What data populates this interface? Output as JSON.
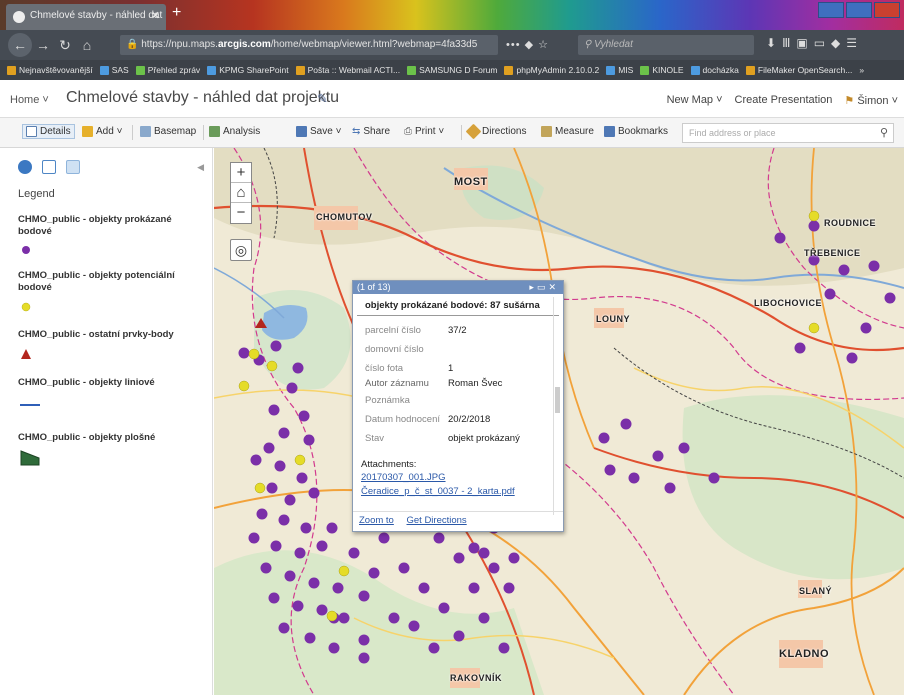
{
  "browser": {
    "tab_title": "Chmelové stavby - náhled dat",
    "new_tab_symbol": "+",
    "url_prefix": "https://npu.maps.",
    "url_domain": "arcgis.com",
    "url_rest": "/home/webmap/viewer.html?webmap=4fa33d5",
    "url_tail": "••• ◆ ☆",
    "search_placeholder": "Vyhledat",
    "bookmarks": [
      "Nejnavštěvovanější",
      "SAS",
      "Přehled zpráv",
      "KPMG SharePoint",
      "Pošta :: Webmail ACTI...",
      "SAMSUNG D Forum",
      "phpMyAdmin 2.10.0.2",
      "MIS",
      "KINOLE",
      "docházka",
      "FileMaker OpenSearch..."
    ],
    "bookmarks_more": "»"
  },
  "header": {
    "home_label": "Home ˅",
    "map_title": "Chmelové stavby - náhled dat projektu",
    "new_map": "New Map ˅",
    "create_presentation": "Create Presentation",
    "user": "Šimon ˅"
  },
  "toolbar": {
    "details": "Details",
    "add": "Add ˅",
    "basemap": "Basemap",
    "analysis": "Analysis",
    "save": "Save ˅",
    "share": "Share",
    "print": "Print ˅",
    "directions": "Directions",
    "measure": "Measure",
    "bookmarks": "Bookmarks",
    "find_placeholder": "Find address or place"
  },
  "legend": {
    "title": "Legend",
    "layers": [
      {
        "name": "CHMO_public - objekty prokázané bodové",
        "symbol": "purple-dot",
        "color": "#7b2fa8"
      },
      {
        "name": "CHMO_public - objekty potenciální bodové",
        "symbol": "yellow-dot",
        "color": "#e5dc28"
      },
      {
        "name": "CHMO_public - ostatní prvky-body",
        "symbol": "red-triangle",
        "color": "#b3261e"
      },
      {
        "name": "CHMO_public - objekty liniové",
        "symbol": "blue-line",
        "color": "#2f5fb8"
      },
      {
        "name": "CHMO_public - objekty plošné",
        "symbol": "green-polygon",
        "color": "#2f6b3a"
      }
    ]
  },
  "map": {
    "place_labels": [
      "MOST",
      "CHOMUTOV",
      "LOUNY",
      "SLANÝ",
      "KLADNO",
      "RAKOVNÍK",
      "LIBOCHOVICE",
      "TŘEBENICE",
      "ROUDNICE"
    ]
  },
  "popup": {
    "counter": "(1 of 13)",
    "title": "objekty prokázané bodové: 87 sušárna",
    "fields": [
      {
        "label": "parcelní číslo",
        "value": "37/2"
      },
      {
        "label": "domovní číslo",
        "value": ""
      },
      {
        "label": "číslo fota",
        "value": "1"
      },
      {
        "label": "Autor záznamu",
        "value": "Roman Švec"
      },
      {
        "label": "Poznámka",
        "value": ""
      },
      {
        "label": "Datum hodnocení",
        "value": "20/2/2018"
      },
      {
        "label": "Stav",
        "value": "objekt prokázaný"
      }
    ],
    "attachments_label": "Attachments:",
    "attachments": [
      "20170307_001.JPG",
      "Čeradice_p_č_st_0037 - 2_karta.pdf"
    ],
    "zoom_to": "Zoom to",
    "get_directions": "Get Directions"
  }
}
